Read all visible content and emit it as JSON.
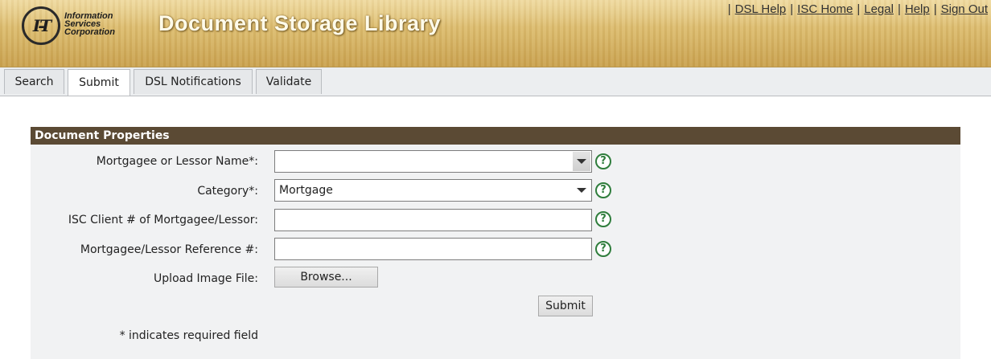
{
  "header": {
    "logo_mark": "I-T",
    "logo_lines": [
      "Information",
      "Services",
      "Corporation"
    ],
    "title": "Document Storage Library",
    "links": [
      "DSL Help",
      "ISC Home",
      "Legal",
      "Help",
      "Sign Out"
    ],
    "separator": "|"
  },
  "tabs": [
    {
      "label": "Search",
      "active": false
    },
    {
      "label": "Submit",
      "active": true
    },
    {
      "label": "DSL Notifications",
      "active": false
    },
    {
      "label": "Validate",
      "active": false
    }
  ],
  "form": {
    "section_title": "Document Properties",
    "fields": {
      "mortgagee_name": {
        "label": "Mortgagee or Lessor Name*:",
        "value": ""
      },
      "category": {
        "label": "Category*:",
        "value": "Mortgage"
      },
      "isc_client": {
        "label": "ISC Client # of Mortgagee/Lessor:",
        "value": ""
      },
      "reference": {
        "label": "Mortgagee/Lessor Reference #:",
        "value": ""
      },
      "upload": {
        "label": "Upload Image File:",
        "button": "Browse..."
      }
    },
    "help_glyph": "?",
    "submit_label": "Submit",
    "required_note": "* indicates required field"
  },
  "colors": {
    "section_header_bg": "#5b4a34",
    "help_icon": "#2f7d3c",
    "panel_bg": "#f1f2f3"
  }
}
